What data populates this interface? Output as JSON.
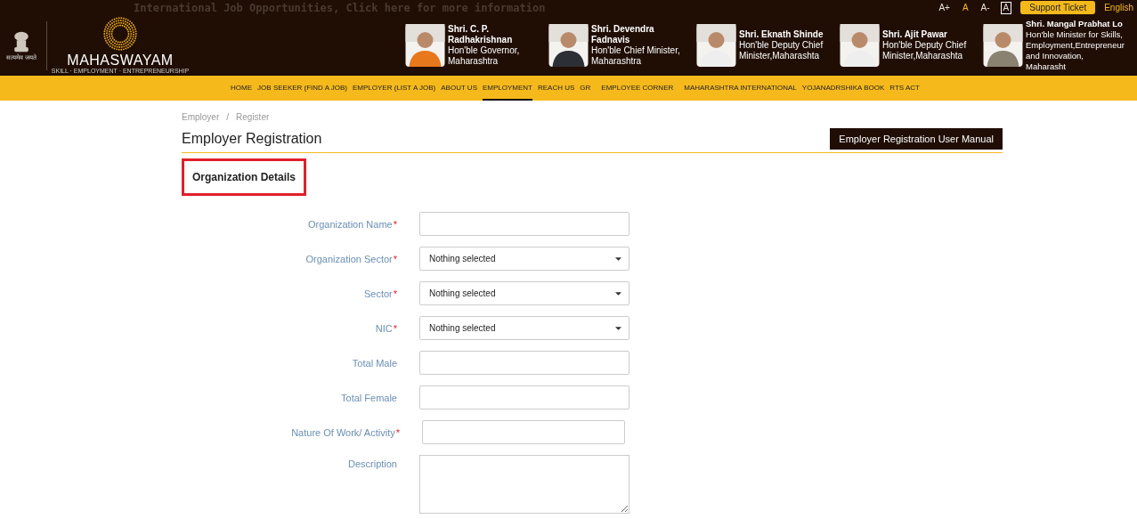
{
  "top_strip": {
    "announcement": "International Job Opportunities, Click here for more information",
    "font_controls": [
      "A+",
      "A",
      "A-",
      "A"
    ],
    "support_button": "Support Ticket",
    "language": "English"
  },
  "header": {
    "emblem_caption": "सत्यमेव जयते",
    "logo_title": "MAHASWAYAM",
    "logo_tagline": "SKILL · EMPLOYMENT · ENTREPRENEURSHIP",
    "leaders": [
      {
        "name": "Shri. C. P. Radhakrishnan",
        "role": "Hon'ble Governor, Maharashtra"
      },
      {
        "name": "Shri. Devendra Fadnavis",
        "role": "Hon'ble Chief Minister, Maharashtra"
      },
      {
        "name": "Shri. Eknath Shinde",
        "role": "Hon'ble Deputy Chief Minister,Maharashta"
      },
      {
        "name": "Shri. Ajit Pawar",
        "role": "Hon'ble Deputy Chief Minister,Maharashta"
      },
      {
        "name": "Shri. Mangal Prabhat Lo",
        "role": "Hon'ble Minister for Skills, Employment,Entrepreneur and Innovation, Maharasht"
      }
    ]
  },
  "nav": [
    {
      "label": "HOME",
      "selected": false
    },
    {
      "label": "JOB SEEKER (FIND A JOB)",
      "selected": false
    },
    {
      "label": "EMPLOYER (LIST A JOB)",
      "selected": false
    },
    {
      "label": "ABOUT US",
      "selected": false
    },
    {
      "label": "EMPLOYMENT",
      "selected": true
    },
    {
      "label": "REACH US",
      "selected": false
    },
    {
      "label": "GR",
      "selected": false
    },
    {
      "label": "EMPLOYEE CORNER",
      "selected": false
    },
    {
      "label": "MAHARASHTRA INTERNATIONAL",
      "selected": false
    },
    {
      "label": "YOJANADRSHIKA BOOK",
      "selected": false
    },
    {
      "label": "RTS ACT",
      "selected": false
    }
  ],
  "breadcrumb": {
    "items": [
      "Employer",
      "Register"
    ],
    "separator": "/"
  },
  "page_title": "Employer Registration",
  "manual_button": "Employer Registration User Manual",
  "section_title": "Organization Details",
  "fields": [
    {
      "label": "Organization Name",
      "required_mark": "*",
      "kind": "text"
    },
    {
      "label": "Organization Sector",
      "required_mark": "*",
      "kind": "select",
      "value": "Nothing selected"
    },
    {
      "label": "Sector",
      "required_mark": "*",
      "kind": "select",
      "value": "Nothing selected"
    },
    {
      "label": "NIC",
      "required_mark": "*",
      "kind": "select",
      "value": "Nothing selected"
    },
    {
      "label": "Total Male",
      "kind": "text"
    },
    {
      "label": "Total Female",
      "kind": "text"
    },
    {
      "label": "Nature Of Work/ Activity",
      "required_mark": "*",
      "kind": "text"
    },
    {
      "label": "Description",
      "kind": "textarea"
    }
  ]
}
